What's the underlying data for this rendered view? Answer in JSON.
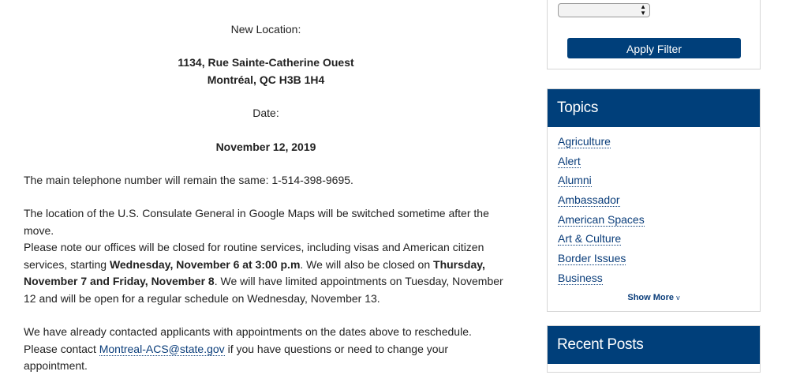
{
  "article": {
    "new_location_label": "New Location:",
    "address_line1": "1134, Rue Sainte-Catherine Ouest",
    "address_line2": "Montréal, QC H3B 1H4",
    "date_label": "Date:",
    "date_value": "November 12, 2019",
    "p_phone": "The main telephone number will remain the same: 1-514-398-9695.",
    "p_maps": "The location of the U.S. Consulate General in Google Maps will be switched sometime after the move.",
    "closure": {
      "t1": "Please note our offices will be closed for routine services, including visas and American citizen services, starting ",
      "b1": "Wednesday, November 6 at 3:00 p.m",
      "t2": ".  We will also be closed on ",
      "b2": "Thursday, November 7 and Friday, November 8",
      "t3": ".  We will have limited appointments on Tuesday, November 12 and will be open for a regular schedule on Wednesday, November 13."
    },
    "contact": {
      "t1": "We have already contacted applicants with appointments on the dates above to reschedule.  Please contact ",
      "email": "Montreal-ACS@state.gov",
      "t2": " if you have questions or need to change your appointment."
    }
  },
  "filter": {
    "apply_label": "Apply Filter"
  },
  "topics": {
    "title": "Topics",
    "items": [
      "Agriculture",
      "Alert",
      "Alumni",
      "Ambassador",
      "American Spaces",
      "Art & Culture",
      "Border Issues",
      "Business"
    ],
    "show_more": "Show More"
  },
  "recent_posts": {
    "title": "Recent Posts"
  },
  "colors": {
    "brand_navy": "#003f7a",
    "link": "#0a3d7a"
  }
}
